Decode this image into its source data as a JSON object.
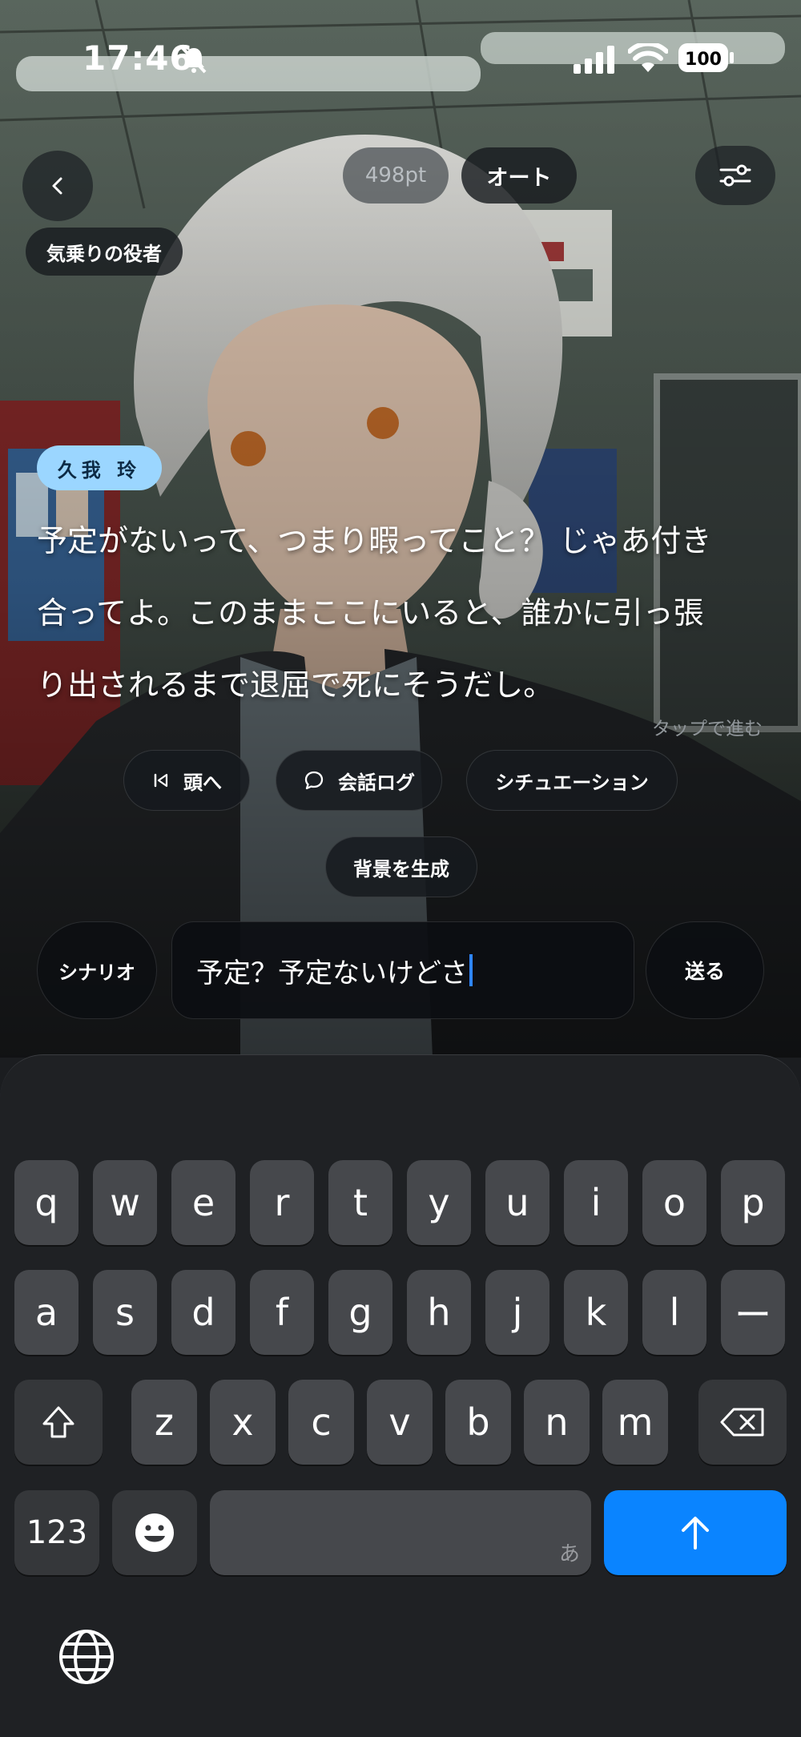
{
  "status_bar": {
    "time": "17:46",
    "battery": "100"
  },
  "top_bar": {
    "points": "498pt",
    "auto_label": "オート",
    "role_label": "気乗りの役者"
  },
  "dialogue": {
    "speaker": "久我 玲",
    "lines": [
      "予定がないって、つまり暇ってこと？ じゃあ付き",
      "合ってよ。このままここにいると、誰かに引っ張",
      "り出されるまで退屈で死にそうだし。"
    ],
    "tap_hint": "タップで進む"
  },
  "actions": {
    "to_start": "頭へ",
    "chat_log": "会話ログ",
    "situation": "シチュエーション",
    "generate_bg": "背景を生成"
  },
  "composer": {
    "scenario_label": "シナリオ",
    "input_value": "予定？予定ないけどさ",
    "send_label": "送る"
  },
  "keyboard": {
    "row1": [
      "q",
      "w",
      "e",
      "r",
      "t",
      "y",
      "u",
      "i",
      "o",
      "p"
    ],
    "row2": [
      "a",
      "s",
      "d",
      "f",
      "g",
      "h",
      "j",
      "k",
      "l",
      "ー"
    ],
    "row3": [
      "z",
      "x",
      "c",
      "v",
      "b",
      "n",
      "m"
    ],
    "num_key": "123",
    "space_hint": "あ",
    "accent_color": "#0a84ff"
  }
}
